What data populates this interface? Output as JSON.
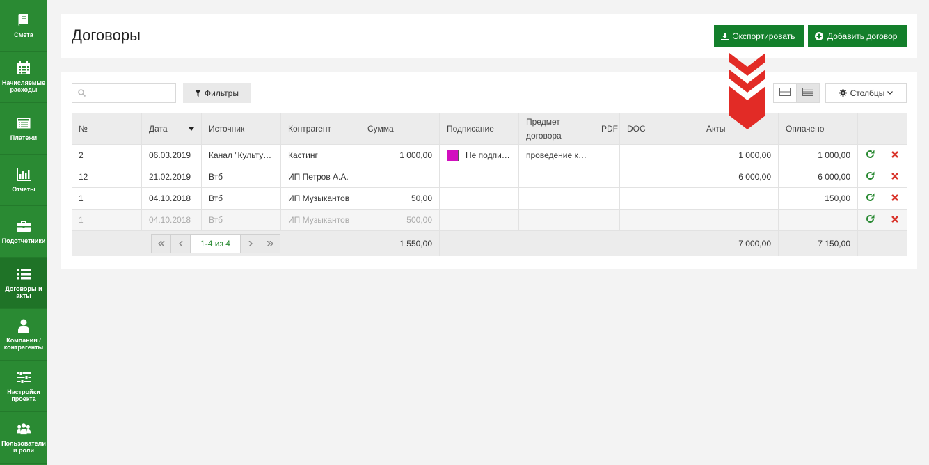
{
  "sidebar": {
    "items": [
      {
        "label": "Смета",
        "icon": "book-icon"
      },
      {
        "label": "Начисляемые расходы",
        "icon": "calendar-icon"
      },
      {
        "label": "Платежи",
        "icon": "list-alt-icon"
      },
      {
        "label": "Отчеты",
        "icon": "bar-chart-icon"
      },
      {
        "label": "Подотчетники",
        "icon": "briefcase-icon"
      },
      {
        "label": "Договоры и акты",
        "icon": "list-icon"
      },
      {
        "label": "Компании / контрагенты",
        "icon": "user-icon"
      },
      {
        "label": "Настройки проекта",
        "icon": "sliders-icon"
      },
      {
        "label": "Пользователи и роли",
        "icon": "users-icon"
      }
    ],
    "active_index": 5,
    "colors": {
      "bg": "#2a8a33",
      "active": "#1f7327"
    }
  },
  "header": {
    "title": "Договоры",
    "export_label": "Экспортировать",
    "add_label": "Добавить договор",
    "button_color": "#137f2b"
  },
  "toolbar": {
    "search_placeholder": "",
    "filter_label": "Фильтры",
    "columns_label": "Столбцы"
  },
  "table": {
    "columns": [
      "№",
      "Дата",
      "Источник",
      "Контрагент",
      "Сумма",
      "Подписание",
      "Предмет договора",
      "PDF",
      "DOC",
      "Акты",
      "Оплачено"
    ],
    "rows": [
      {
        "no": "2",
        "date": "06.03.2019",
        "source": "Канал \"Культура\"",
        "counterparty": "Кастинг",
        "amount": "1 000,00",
        "signing": "Не подписан",
        "signing_color": "#d20fbf",
        "subject": "проведение кастинга",
        "pdf": "",
        "doc": "",
        "acts": "1 000,00",
        "paid": "1 000,00",
        "muted": false
      },
      {
        "no": "12",
        "date": "21.02.2019",
        "source": "Втб",
        "counterparty": "ИП Петров А.А.",
        "amount": "",
        "signing": "",
        "subject": "",
        "pdf": "",
        "doc": "",
        "acts": "6 000,00",
        "paid": "6 000,00",
        "muted": false
      },
      {
        "no": "1",
        "date": "04.10.2018",
        "source": "Втб",
        "counterparty": "ИП Музыкантов",
        "amount": "50,00",
        "signing": "",
        "subject": "",
        "pdf": "",
        "doc": "",
        "acts": "",
        "paid": "150,00",
        "muted": false
      },
      {
        "no": "1",
        "date": "04.10.2018",
        "source": "Втб",
        "counterparty": "ИП Музыкантов",
        "amount": "500,00",
        "signing": "",
        "subject": "",
        "pdf": "",
        "doc": "",
        "acts": "",
        "paid": "",
        "muted": true
      }
    ],
    "footer": {
      "page_info": "1-4 из 4",
      "amount_total": "1 550,00",
      "acts_total": "7 000,00",
      "paid_total": "7 150,00"
    }
  },
  "annotation": {
    "color": "#e22b26"
  }
}
